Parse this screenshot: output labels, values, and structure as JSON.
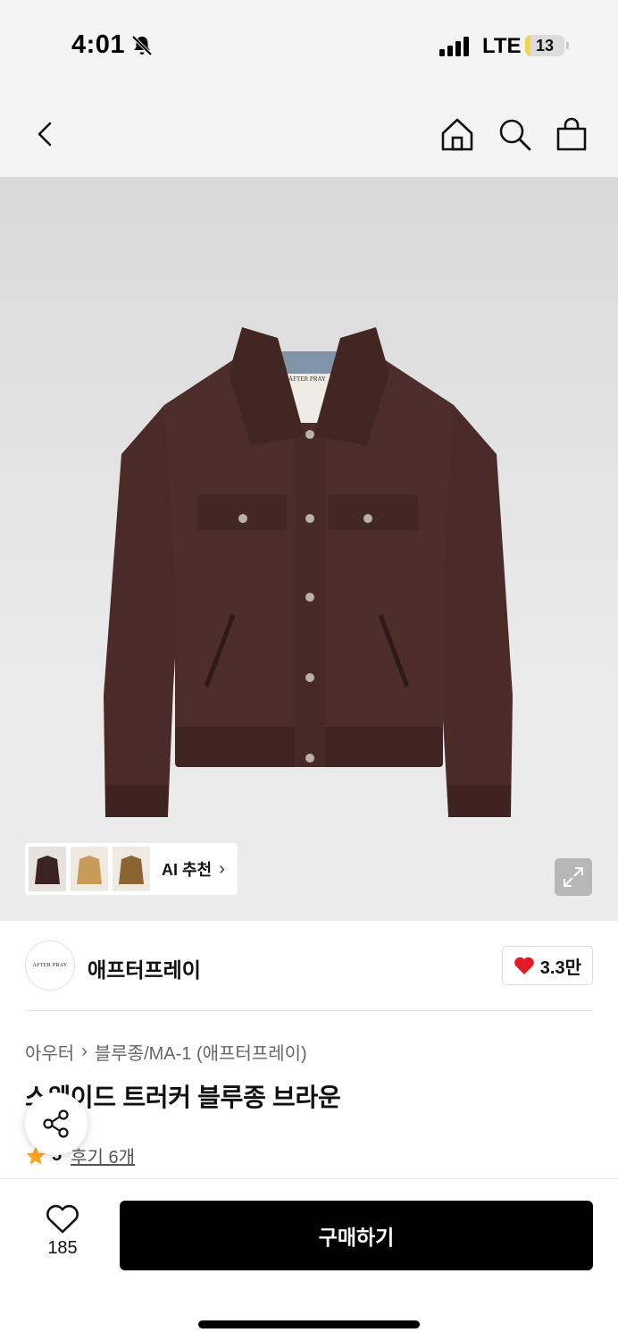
{
  "status_bar": {
    "time": "4:01",
    "network": "LTE",
    "battery": "13",
    "battery_level": 0.13
  },
  "nav": {
    "back_icon": "chevron-left-icon",
    "home_icon": "home-icon",
    "search_icon": "search-icon",
    "cart_icon": "shopping-bag-icon"
  },
  "hero": {
    "ai_recommend_label": "AI 추천",
    "expand_icon": "expand-icon"
  },
  "brand": {
    "logo_text": "AFTER PRAY",
    "name": "애프터프레이",
    "likes": "3.3만"
  },
  "product": {
    "breadcrumb": [
      "아우터",
      "블루종/MA-1 (애프터프레이)"
    ],
    "title": "스웨이드 트러커 블루종 브라운",
    "rating": "5",
    "review_label": "후기 6개"
  },
  "bottom": {
    "wish_count": "185",
    "buy_label": "구매하기"
  },
  "colors": {
    "accent": "#e31b23",
    "star": "#f5a623",
    "jacket": "#4a2a26",
    "buy_button": "#000000"
  }
}
